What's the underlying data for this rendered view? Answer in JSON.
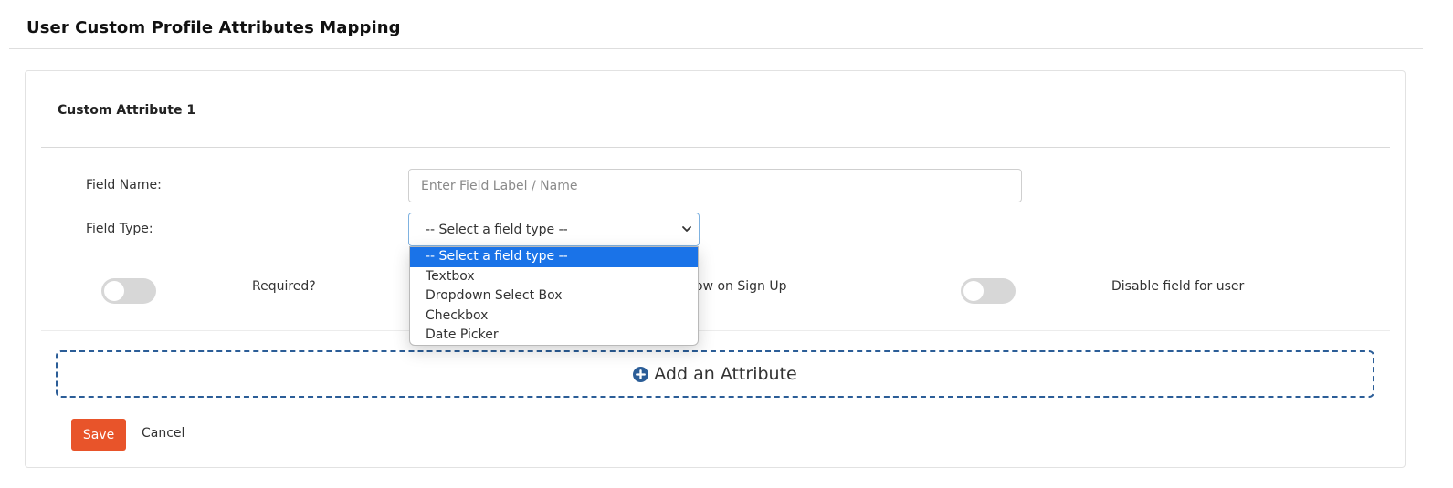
{
  "page": {
    "title": "User Custom Profile Attributes Mapping"
  },
  "attribute": {
    "heading": "Custom Attribute 1",
    "field_name": {
      "label": "Field Name:",
      "placeholder": "Enter Field Label / Name",
      "value": ""
    },
    "field_type": {
      "label": "Field Type:",
      "selected": "-- Select a field type --",
      "options": [
        "-- Select a field type --",
        "Textbox",
        "Dropdown Select Box",
        "Checkbox",
        "Date Picker"
      ]
    },
    "toggles": {
      "required": {
        "label": "Required?",
        "on": false
      },
      "show_on_signup": {
        "label": "ow on Sign Up",
        "on": false
      },
      "disable_for_user": {
        "label": "Disable field for user",
        "on": false
      }
    }
  },
  "actions": {
    "add_attribute": "Add an Attribute",
    "save": "Save",
    "cancel": "Cancel"
  },
  "colors": {
    "accent": "#e8542a",
    "selected_option": "#1a73e8",
    "dashed_border": "#2b5d97"
  }
}
